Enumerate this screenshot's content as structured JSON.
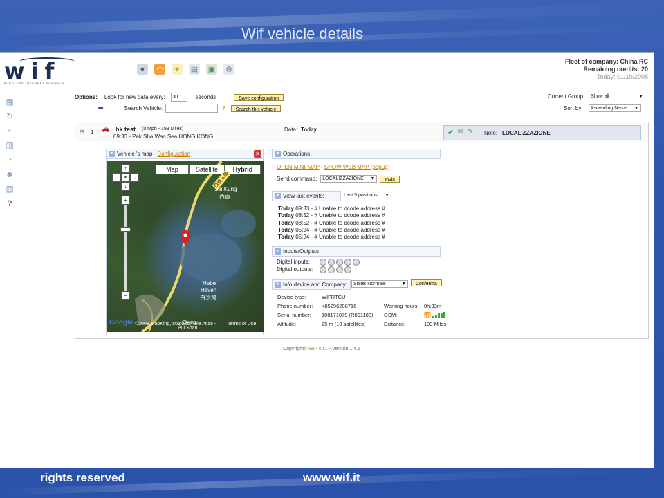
{
  "slide": {
    "title": "Wif vehicle details",
    "footer_left": "rights reserved",
    "footer_right": "www.wif.it"
  },
  "logo": {
    "main": "wif",
    "sub": "WIRELESS INTERNET FORMULA"
  },
  "fleet": {
    "company": "Fleet of company: China RC",
    "credits": "Remaining credits: 20",
    "today": "Today: 01/10/2008"
  },
  "options": {
    "label": "Options:",
    "look_label": "Look for new data every:",
    "interval_value": "30",
    "seconds_label": "seconds",
    "save_btn": "Save configuration",
    "search_label": "Search Vehicle:",
    "search_value": "",
    "help": "?",
    "search_btn": "Search this vehicle",
    "group_label": "Current Group",
    "group_value": "Show all",
    "sort_label": "Sort by:",
    "sort_value": "Ascending Name"
  },
  "vehicle": {
    "index": "1",
    "collapse": "⊟",
    "name": "hk test",
    "speed": "(0 Mph - 193 Miles)",
    "location": "09:33 - Pak Sha Wan Sea HONG KONG",
    "data_label": "Data:",
    "data_value": "Today",
    "note_label": "Note:",
    "note_value": "LOCALIZZAZIONE"
  },
  "map_box": {
    "title": "Vehicle 's map -",
    "config_link": "Configuration",
    "btn_map": "Map",
    "btn_sat": "Satellite",
    "btn_hybrid": "Hybrid",
    "label_saikung": "Sai Kung",
    "label_saikung_cn": "西貢",
    "label_hebe": "Hebe",
    "label_haven": "Haven",
    "label_haven_cn": "白沙灣",
    "label_road": "西貢公路",
    "label_chung": "Chung",
    "label_pui": "Pui Shan",
    "attribution": "©2008 MapKing, Mapabc, Tele Atlas -",
    "terms": "Terms of Use",
    "google": "Google"
  },
  "operations": {
    "title": "Operations",
    "open_mini": "OPEN MINI-MAP",
    "sep": " - ",
    "show_web": "SHOW WEB MAP (popup)",
    "send_label": "Send command:",
    "command_value": "LOCALIZZAZIONE",
    "invia_btn": "Invia"
  },
  "events": {
    "title": "View last events:",
    "positions_value": "Last 5 positions",
    "items": [
      {
        "day": "Today",
        "text": "09:33 - # Unable to dcode address #"
      },
      {
        "day": "Today",
        "text": "08:52 - # Unable to dcode address #"
      },
      {
        "day": "Today",
        "text": "08:52 - # Unable to dcode address #"
      },
      {
        "day": "Today",
        "text": "05:24 - # Unable to dcode address #"
      },
      {
        "day": "Today",
        "text": "05:24 - # Unable to dcode address #"
      }
    ]
  },
  "io": {
    "title": "Inputs/Outputs",
    "digital_inputs": "Digital inputs:",
    "digital_outputs": "Digital outputs:"
  },
  "device": {
    "title": "Info device and Company:",
    "state_value": "State: Normale",
    "conferma_btn": "Conferma",
    "type_label": "Device type:",
    "type_value": "WIFRTCU",
    "phone_label": "Phone number:",
    "phone_value": "+85296288716",
    "hours_label": "Working hours:",
    "hours_value": "0h:33m",
    "serial_label": "Serial number:",
    "serial_value": "108171079 (R001103)",
    "gsm_label": "GSM:",
    "alt_label": "Altitude:",
    "alt_value": "25 m (10 satellites)",
    "dist_label": "Distance:",
    "dist_value": "193 Miles"
  },
  "copyright": {
    "text": "Copyright©",
    "company": "WIF s.r.l.",
    "version": "- Version 1.4.5"
  },
  "colors": {
    "accent": "#c47b00",
    "button_bg": "#fff2b8",
    "slide_bg": "#2d55ad"
  }
}
